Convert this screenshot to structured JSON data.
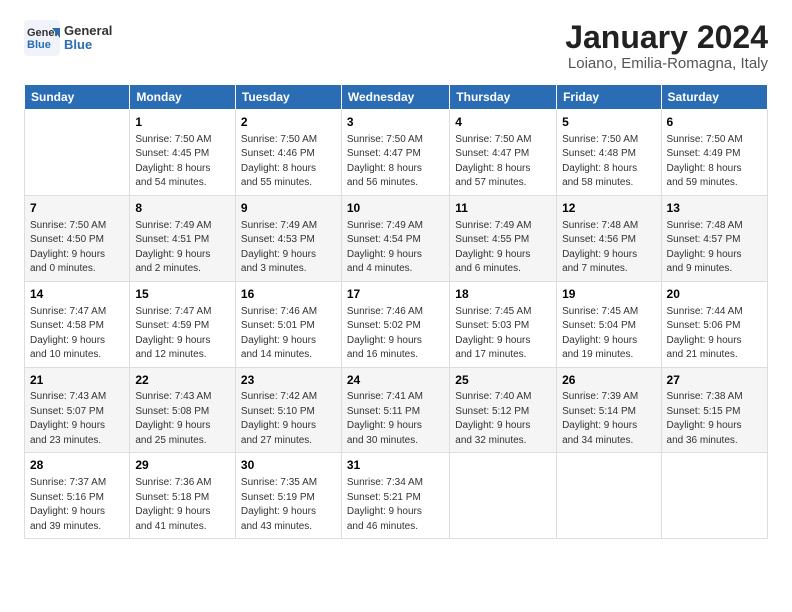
{
  "header": {
    "logo_general": "General",
    "logo_blue": "Blue",
    "title": "January 2024",
    "subtitle": "Loiano, Emilia-Romagna, Italy"
  },
  "columns": [
    "Sunday",
    "Monday",
    "Tuesday",
    "Wednesday",
    "Thursday",
    "Friday",
    "Saturday"
  ],
  "weeks": [
    [
      {
        "day": "",
        "info": ""
      },
      {
        "day": "1",
        "info": "Sunrise: 7:50 AM\nSunset: 4:45 PM\nDaylight: 8 hours\nand 54 minutes."
      },
      {
        "day": "2",
        "info": "Sunrise: 7:50 AM\nSunset: 4:46 PM\nDaylight: 8 hours\nand 55 minutes."
      },
      {
        "day": "3",
        "info": "Sunrise: 7:50 AM\nSunset: 4:47 PM\nDaylight: 8 hours\nand 56 minutes."
      },
      {
        "day": "4",
        "info": "Sunrise: 7:50 AM\nSunset: 4:47 PM\nDaylight: 8 hours\nand 57 minutes."
      },
      {
        "day": "5",
        "info": "Sunrise: 7:50 AM\nSunset: 4:48 PM\nDaylight: 8 hours\nand 58 minutes."
      },
      {
        "day": "6",
        "info": "Sunrise: 7:50 AM\nSunset: 4:49 PM\nDaylight: 8 hours\nand 59 minutes."
      }
    ],
    [
      {
        "day": "7",
        "info": "Sunrise: 7:50 AM\nSunset: 4:50 PM\nDaylight: 9 hours\nand 0 minutes."
      },
      {
        "day": "8",
        "info": "Sunrise: 7:49 AM\nSunset: 4:51 PM\nDaylight: 9 hours\nand 2 minutes."
      },
      {
        "day": "9",
        "info": "Sunrise: 7:49 AM\nSunset: 4:53 PM\nDaylight: 9 hours\nand 3 minutes."
      },
      {
        "day": "10",
        "info": "Sunrise: 7:49 AM\nSunset: 4:54 PM\nDaylight: 9 hours\nand 4 minutes."
      },
      {
        "day": "11",
        "info": "Sunrise: 7:49 AM\nSunset: 4:55 PM\nDaylight: 9 hours\nand 6 minutes."
      },
      {
        "day": "12",
        "info": "Sunrise: 7:48 AM\nSunset: 4:56 PM\nDaylight: 9 hours\nand 7 minutes."
      },
      {
        "day": "13",
        "info": "Sunrise: 7:48 AM\nSunset: 4:57 PM\nDaylight: 9 hours\nand 9 minutes."
      }
    ],
    [
      {
        "day": "14",
        "info": "Sunrise: 7:47 AM\nSunset: 4:58 PM\nDaylight: 9 hours\nand 10 minutes."
      },
      {
        "day": "15",
        "info": "Sunrise: 7:47 AM\nSunset: 4:59 PM\nDaylight: 9 hours\nand 12 minutes."
      },
      {
        "day": "16",
        "info": "Sunrise: 7:46 AM\nSunset: 5:01 PM\nDaylight: 9 hours\nand 14 minutes."
      },
      {
        "day": "17",
        "info": "Sunrise: 7:46 AM\nSunset: 5:02 PM\nDaylight: 9 hours\nand 16 minutes."
      },
      {
        "day": "18",
        "info": "Sunrise: 7:45 AM\nSunset: 5:03 PM\nDaylight: 9 hours\nand 17 minutes."
      },
      {
        "day": "19",
        "info": "Sunrise: 7:45 AM\nSunset: 5:04 PM\nDaylight: 9 hours\nand 19 minutes."
      },
      {
        "day": "20",
        "info": "Sunrise: 7:44 AM\nSunset: 5:06 PM\nDaylight: 9 hours\nand 21 minutes."
      }
    ],
    [
      {
        "day": "21",
        "info": "Sunrise: 7:43 AM\nSunset: 5:07 PM\nDaylight: 9 hours\nand 23 minutes."
      },
      {
        "day": "22",
        "info": "Sunrise: 7:43 AM\nSunset: 5:08 PM\nDaylight: 9 hours\nand 25 minutes."
      },
      {
        "day": "23",
        "info": "Sunrise: 7:42 AM\nSunset: 5:10 PM\nDaylight: 9 hours\nand 27 minutes."
      },
      {
        "day": "24",
        "info": "Sunrise: 7:41 AM\nSunset: 5:11 PM\nDaylight: 9 hours\nand 30 minutes."
      },
      {
        "day": "25",
        "info": "Sunrise: 7:40 AM\nSunset: 5:12 PM\nDaylight: 9 hours\nand 32 minutes."
      },
      {
        "day": "26",
        "info": "Sunrise: 7:39 AM\nSunset: 5:14 PM\nDaylight: 9 hours\nand 34 minutes."
      },
      {
        "day": "27",
        "info": "Sunrise: 7:38 AM\nSunset: 5:15 PM\nDaylight: 9 hours\nand 36 minutes."
      }
    ],
    [
      {
        "day": "28",
        "info": "Sunrise: 7:37 AM\nSunset: 5:16 PM\nDaylight: 9 hours\nand 39 minutes."
      },
      {
        "day": "29",
        "info": "Sunrise: 7:36 AM\nSunset: 5:18 PM\nDaylight: 9 hours\nand 41 minutes."
      },
      {
        "day": "30",
        "info": "Sunrise: 7:35 AM\nSunset: 5:19 PM\nDaylight: 9 hours\nand 43 minutes."
      },
      {
        "day": "31",
        "info": "Sunrise: 7:34 AM\nSunset: 5:21 PM\nDaylight: 9 hours\nand 46 minutes."
      },
      {
        "day": "",
        "info": ""
      },
      {
        "day": "",
        "info": ""
      },
      {
        "day": "",
        "info": ""
      }
    ]
  ]
}
